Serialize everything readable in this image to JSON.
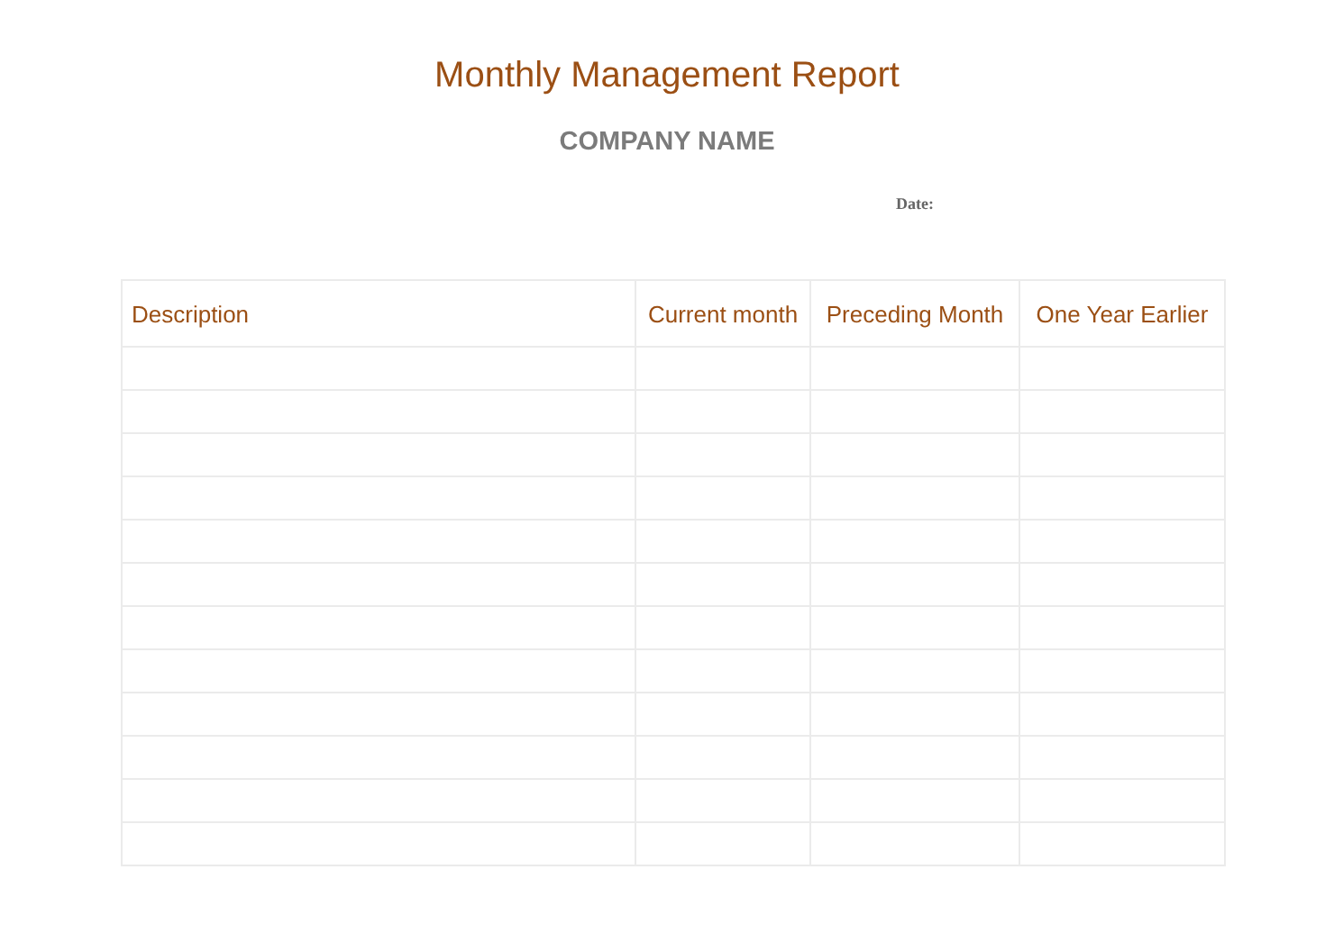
{
  "report": {
    "title": "Monthly Management Report",
    "company": "COMPANY NAME",
    "date_label": "Date:"
  },
  "table": {
    "columns": [
      "Description",
      "Current month",
      "Preceding Month",
      "One Year Earlier"
    ],
    "rows": [
      {
        "kind": "blank"
      },
      {
        "kind": "blank"
      },
      {
        "kind": "blank"
      },
      {
        "kind": "blank"
      },
      {
        "kind": "blank"
      },
      {
        "kind": "blank"
      },
      {
        "kind": "blank"
      },
      {
        "kind": "blank"
      },
      {
        "kind": "blank"
      },
      {
        "kind": "blank"
      },
      {
        "kind": "blank"
      },
      {
        "kind": "blank"
      }
    ]
  }
}
